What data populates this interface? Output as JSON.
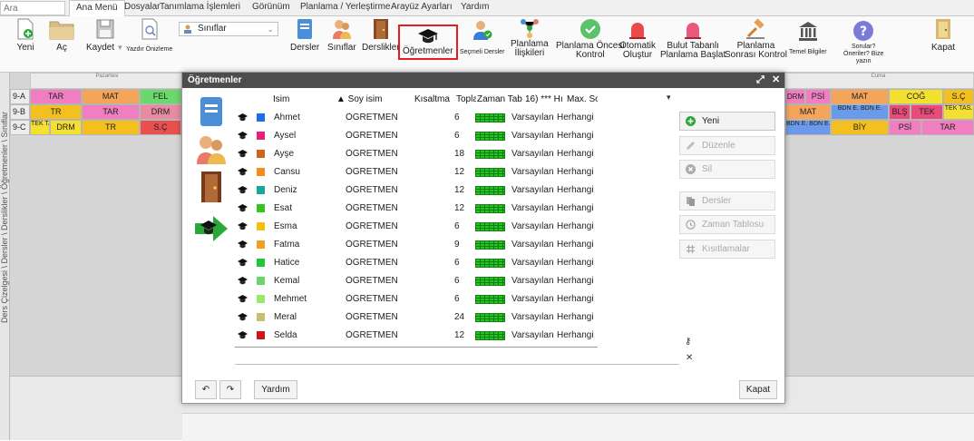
{
  "search": {
    "placeholder": "Ara"
  },
  "menubar": {
    "tabs": [
      "Ana Menü",
      "Dosyalar",
      "Tanımlama İşlemleri",
      "Görünüm",
      "Planlama / Yerleştirme",
      "Arayüz Ayarları",
      "Yardım"
    ],
    "active": "Ana Menü"
  },
  "ribbon": {
    "yeni": "Yeni",
    "ac": "Aç",
    "kaydet": "Kaydet",
    "yazdir": "Yazdır Önizleme",
    "siniflar_select": "Sınıflar",
    "dersler": "Dersler",
    "siniflar": "Sınıflar",
    "derslikler": "Derslikler",
    "ogretmenler": "Öğretmenler",
    "secmeli": "Seçmeli Dersler",
    "planlama_iliskileri_1": "Planlama",
    "planlama_iliskileri_2": "İlişkileri",
    "planlama_oncesi_1": "Planlama Öncesi",
    "planlama_oncesi_2": "Kontrol",
    "otomatik_1": "Otomatik",
    "otomatik_2": "Oluştur",
    "bulut_1": "Bulut Tabanlı",
    "bulut_2": "Planlama Başlat",
    "planlama_sonrasi_1": "Planlama",
    "planlama_sonrasi_2": "Sonrası Kontrol",
    "temel": "Temel Bilgiler",
    "sorular_1": "Sorular?",
    "sorular_2": "Öneriler? Bize",
    "sorular_3": "yazın",
    "kapat": "Kapat"
  },
  "vertical_tabs": "Ders Çizelgesi \\ Dersler \\ Derslikler \\ Öğretmenler \\ Sınıflar",
  "timetable": {
    "days": {
      "pazartesi": "Pazartesi",
      "cuma": "Cuma"
    },
    "rows": [
      "9-A",
      "9-B",
      "9-C"
    ],
    "left_cells": [
      [
        "TAR",
        "MAT",
        "FEL"
      ],
      [
        "TR",
        "TAR",
        "DRM"
      ],
      [
        "TEK TAS",
        "DRM",
        "TR",
        "S.Ç"
      ]
    ],
    "right_cells": [
      [
        "DRM",
        "PSİ",
        "MAT",
        "COĞ",
        "S.Ç"
      ],
      [
        "MAT",
        "BDN E. BDN E.",
        "BLŞ",
        "TEK",
        "TEK TAS."
      ],
      [
        "BDN E. BDN E.",
        "BİY",
        "PSİ",
        "TAR"
      ]
    ]
  },
  "dialog": {
    "title": "Öğretmenler",
    "columns": {
      "isim": "İsim",
      "soyisim": "▲ Soy isim",
      "kisaltma": "Kısaltma",
      "toplam": "Topla",
      "zaman": "Zaman Tab",
      "hi": "16) *** Hı",
      "max": "Max. Sor"
    },
    "teachers": [
      {
        "name": "Ahmet",
        "surname": "ÖĞRETMEN",
        "total": "6",
        "tt": "Varsayılan",
        "max": "Herhangi",
        "color": "#1e6ee8"
      },
      {
        "name": "Aysel",
        "surname": "ÖĞRETMEN",
        "total": "6",
        "tt": "Varsayılan",
        "max": "Herhangi",
        "color": "#e8207a"
      },
      {
        "name": "Ayşe",
        "surname": "ÖĞRETMEN",
        "total": "18",
        "tt": "Varsayılan",
        "max": "Herhangi",
        "color": "#d0641c"
      },
      {
        "name": "Cansu",
        "surname": "ÖĞRETMEN",
        "total": "12",
        "tt": "Varsayılan",
        "max": "Herhangi",
        "color": "#f28c1e"
      },
      {
        "name": "Deniz",
        "surname": "ÖĞRETMEN",
        "total": "12",
        "tt": "Varsayılan",
        "max": "Herhangi",
        "color": "#17a89a"
      },
      {
        "name": "Esat",
        "surname": "ÖĞRETMEN",
        "total": "12",
        "tt": "Varsayılan",
        "max": "Herhangi",
        "color": "#38c21e"
      },
      {
        "name": "Esma",
        "surname": "ÖĞRETMEN",
        "total": "6",
        "tt": "Varsayılan",
        "max": "Herhangi",
        "color": "#f4c010"
      },
      {
        "name": "Fatma",
        "surname": "ÖĞRETMEN",
        "total": "9",
        "tt": "Varsayılan",
        "max": "Herhangi",
        "color": "#f2a01c"
      },
      {
        "name": "Hatice",
        "surname": "ÖĞRETMEN",
        "total": "6",
        "tt": "Varsayılan",
        "max": "Herhangi",
        "color": "#22c43a"
      },
      {
        "name": "Kemal",
        "surname": "ÖĞRETMEN",
        "total": "6",
        "tt": "Varsayılan",
        "max": "Herhangi",
        "color": "#6cd46c"
      },
      {
        "name": "Mehmet",
        "surname": "ÖĞRETMEN",
        "total": "6",
        "tt": "Varsayılan",
        "max": "Herhangi",
        "color": "#9aea6a"
      },
      {
        "name": "Meral",
        "surname": "ÖĞRETMEN",
        "total": "24",
        "tt": "Varsayılan",
        "max": "Herhangi",
        "color": "#c4c070"
      },
      {
        "name": "Selda",
        "surname": "ÖĞRETMEN",
        "total": "12",
        "tt": "Varsayılan",
        "max": "Herhangi",
        "color": "#d0141c"
      }
    ],
    "buttons": {
      "yeni": "Yeni",
      "duzenle": "Düzenle",
      "sil": "Sil",
      "dersler": "Dersler",
      "zaman": "Zaman Tablosu",
      "kisitlamalar": "Kısıtlamalar"
    },
    "footer": {
      "yardim": "Yardım",
      "kapat": "Kapat"
    }
  },
  "colors": {
    "highlight": "#e02020",
    "dialog_title_bg": "#4d4d4d",
    "accent_green": "#2aa83a"
  }
}
